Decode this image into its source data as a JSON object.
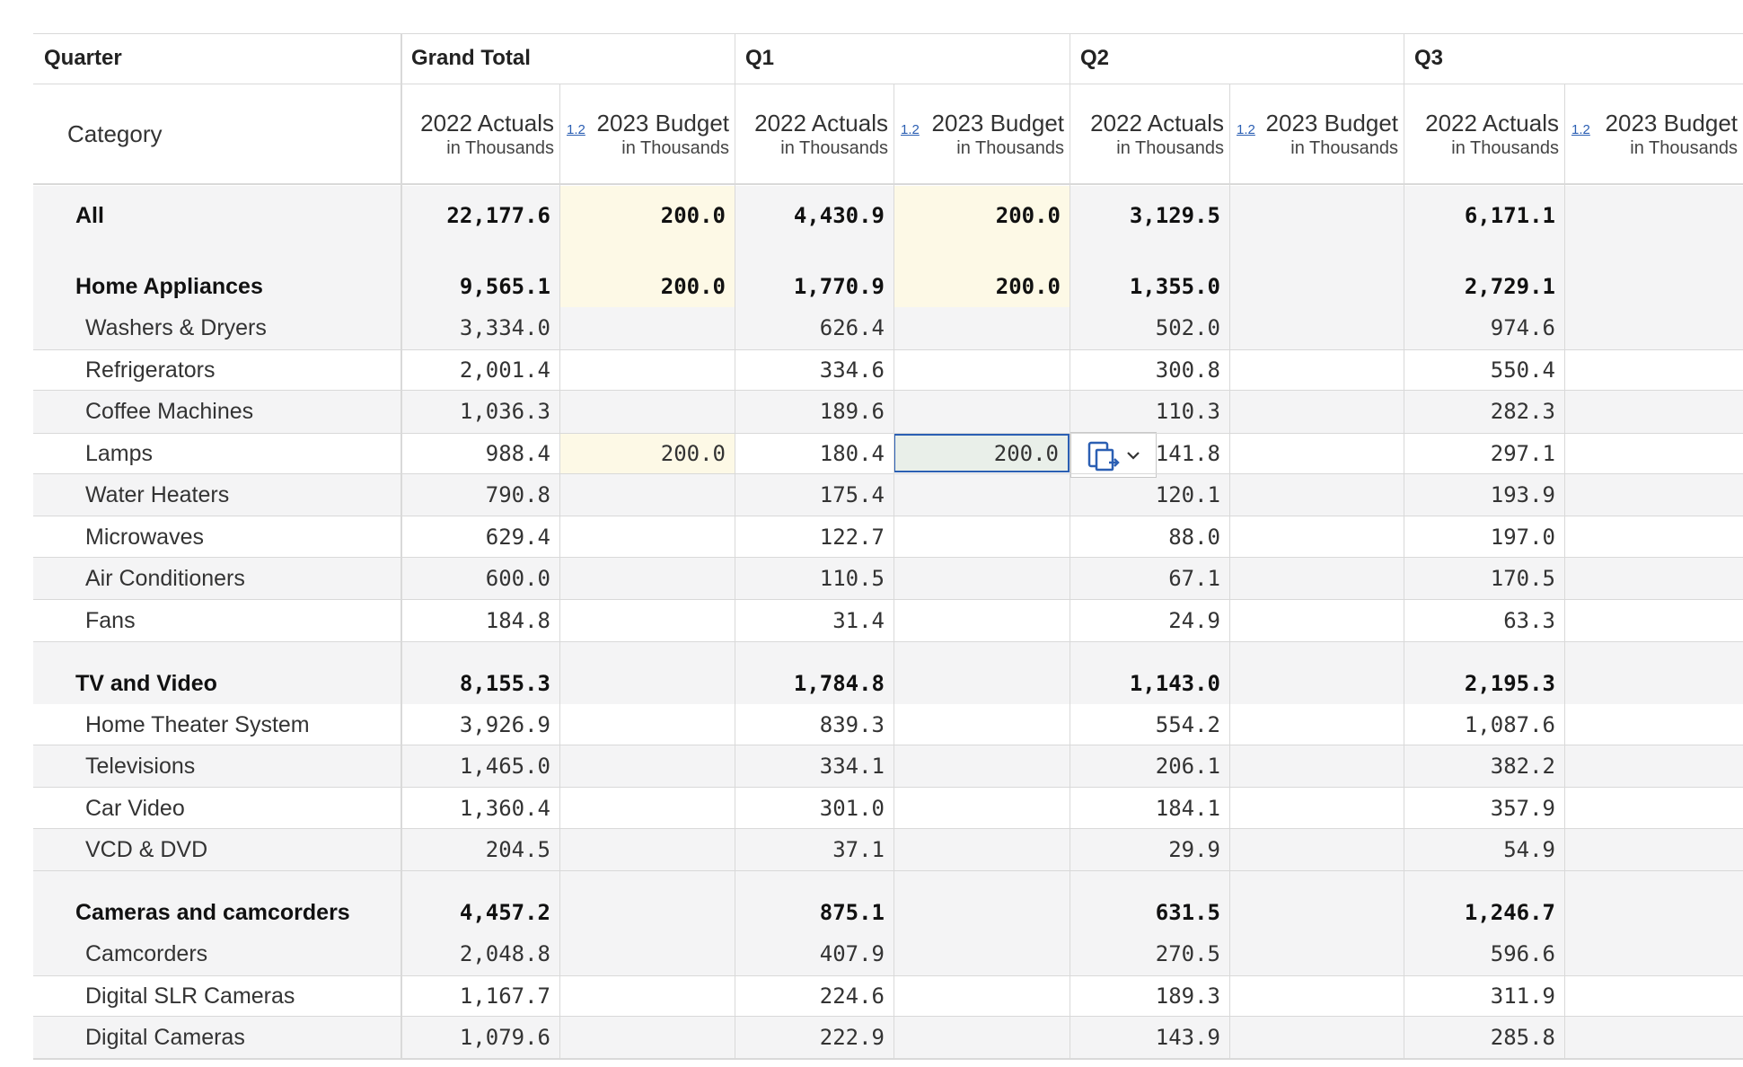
{
  "header": {
    "quarter_label": "Quarter",
    "category_label": "Category",
    "groups": [
      "Grand Total",
      "Q1",
      "Q2",
      "Q3"
    ],
    "sub_title_1": "2022 Actuals",
    "sub_title_2": "2023 Budget",
    "sub_unit": "in Thousands",
    "badge": "1.2"
  },
  "colors": {
    "budget_highlight": "#fdf9e6",
    "selected_cell": "#e9efe9",
    "selected_border": "#2b5fb3",
    "row_band": "#f4f4f5"
  },
  "rows": [
    {
      "label": "All",
      "type": "total",
      "values": [
        "22,177.6",
        "200.0",
        "4,430.9",
        "200.0",
        "3,129.5",
        "",
        "6,171.1",
        ""
      ],
      "highlight": [
        1,
        3
      ]
    },
    {
      "label": "Home Appliances",
      "type": "group",
      "values": [
        "9,565.1",
        "200.0",
        "1,770.9",
        "200.0",
        "1,355.0",
        "",
        "2,729.1",
        ""
      ],
      "highlight": [
        1,
        3
      ]
    },
    {
      "label": "Washers & Dryers",
      "type": "item",
      "values": [
        "3,334.0",
        "",
        "626.4",
        "",
        "502.0",
        "",
        "974.6",
        ""
      ]
    },
    {
      "label": "Refrigerators",
      "type": "item",
      "values": [
        "2,001.4",
        "",
        "334.6",
        "",
        "300.8",
        "",
        "550.4",
        ""
      ]
    },
    {
      "label": "Coffee Machines",
      "type": "item",
      "values": [
        "1,036.3",
        "",
        "189.6",
        "",
        "110.3",
        "",
        "282.3",
        ""
      ]
    },
    {
      "label": "Lamps",
      "type": "item",
      "values": [
        "988.4",
        "200.0",
        "180.4",
        "200.0",
        "141.8",
        "",
        "297.1",
        ""
      ],
      "highlight": [
        1
      ],
      "selected": 3
    },
    {
      "label": "Water Heaters",
      "type": "item",
      "values": [
        "790.8",
        "",
        "175.4",
        "",
        "120.1",
        "",
        "193.9",
        ""
      ]
    },
    {
      "label": "Microwaves",
      "type": "item",
      "values": [
        "629.4",
        "",
        "122.7",
        "",
        "88.0",
        "",
        "197.0",
        ""
      ]
    },
    {
      "label": "Air Conditioners",
      "type": "item",
      "values": [
        "600.0",
        "",
        "110.5",
        "",
        "67.1",
        "",
        "170.5",
        ""
      ]
    },
    {
      "label": "Fans",
      "type": "item",
      "values": [
        "184.8",
        "",
        "31.4",
        "",
        "24.9",
        "",
        "63.3",
        ""
      ]
    },
    {
      "label": "TV and Video",
      "type": "group",
      "values": [
        "8,155.3",
        "",
        "1,784.8",
        "",
        "1,143.0",
        "",
        "2,195.3",
        ""
      ]
    },
    {
      "label": "Home Theater System",
      "type": "item",
      "values": [
        "3,926.9",
        "",
        "839.3",
        "",
        "554.2",
        "",
        "1,087.6",
        ""
      ]
    },
    {
      "label": "Televisions",
      "type": "item",
      "values": [
        "1,465.0",
        "",
        "334.1",
        "",
        "206.1",
        "",
        "382.2",
        ""
      ]
    },
    {
      "label": "Car Video",
      "type": "item",
      "values": [
        "1,360.4",
        "",
        "301.0",
        "",
        "184.1",
        "",
        "357.9",
        ""
      ]
    },
    {
      "label": "VCD & DVD",
      "type": "item",
      "values": [
        "204.5",
        "",
        "37.1",
        "",
        "29.9",
        "",
        "54.9",
        ""
      ]
    },
    {
      "label": "Cameras and camcorders",
      "type": "group",
      "values": [
        "4,457.2",
        "",
        "875.1",
        "",
        "631.5",
        "",
        "1,246.7",
        ""
      ]
    },
    {
      "label": "Camcorders",
      "type": "item",
      "values": [
        "2,048.8",
        "",
        "407.9",
        "",
        "270.5",
        "",
        "596.6",
        ""
      ]
    },
    {
      "label": "Digital SLR Cameras",
      "type": "item",
      "values": [
        "1,167.7",
        "",
        "224.6",
        "",
        "189.3",
        "",
        "311.9",
        ""
      ]
    },
    {
      "label": "Digital Cameras",
      "type": "item",
      "values": [
        "1,079.6",
        "",
        "222.9",
        "",
        "143.9",
        "",
        "285.8",
        ""
      ]
    }
  ],
  "paste_options": {
    "icon": "paste-icon",
    "chevron": "chevron-down-icon"
  }
}
